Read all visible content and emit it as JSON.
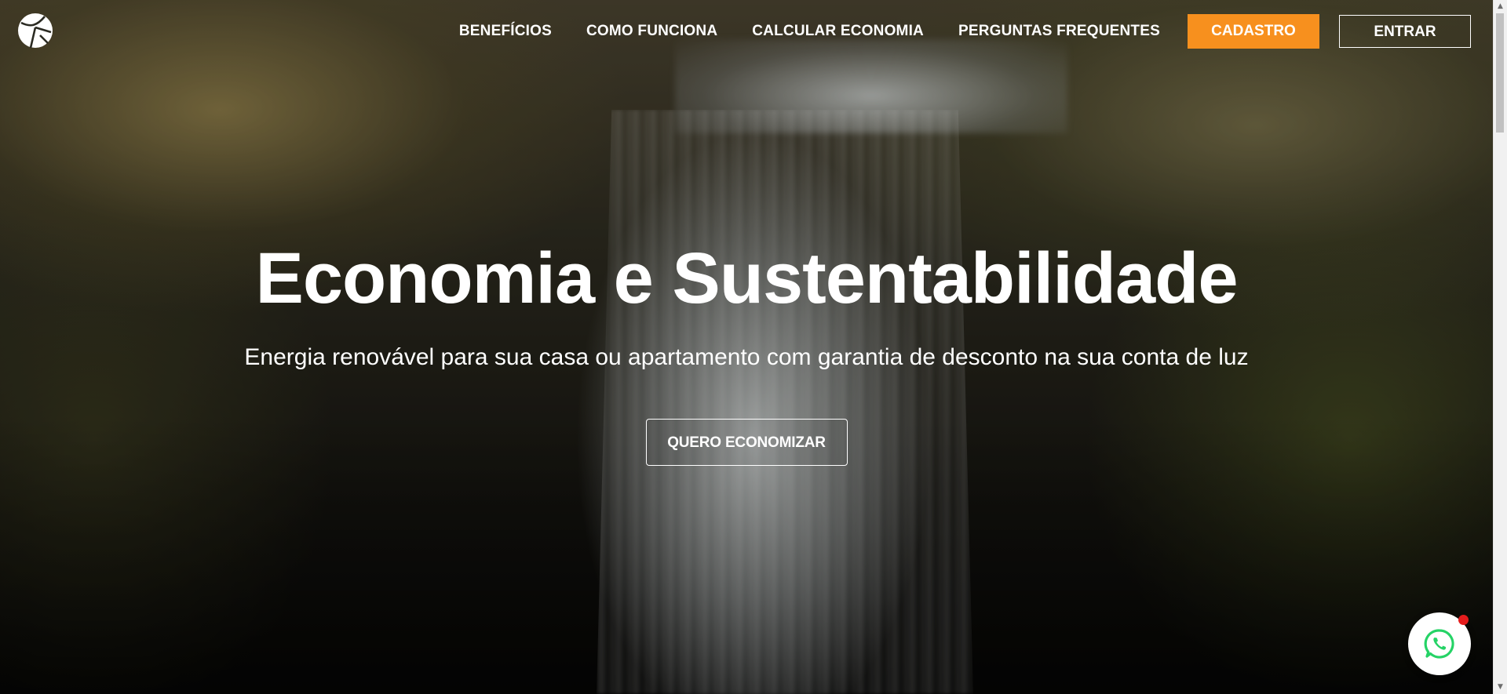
{
  "header": {
    "logo_icon": "globe-leaf-logo",
    "nav": [
      {
        "label": "BENEFÍCIOS"
      },
      {
        "label": "COMO FUNCIONA"
      },
      {
        "label": "CALCULAR ECONOMIA"
      },
      {
        "label": "PERGUNTAS FREQUENTES"
      }
    ],
    "cadastro_label": "CADASTRO",
    "entrar_label": "ENTRAR"
  },
  "hero": {
    "title": "Economia e Sustentabilidade",
    "subtitle": "Energia renovável para sua casa ou apartamento com garantia de desconto na sua conta de luz",
    "cta_label": "QUERO ECONOMIZAR"
  },
  "whatsapp": {
    "icon": "whatsapp-icon",
    "has_notification": true
  },
  "colors": {
    "accent": "#f7901e",
    "text": "#ffffff",
    "whatsapp_green": "#25d366",
    "notification": "#e51c1c"
  }
}
